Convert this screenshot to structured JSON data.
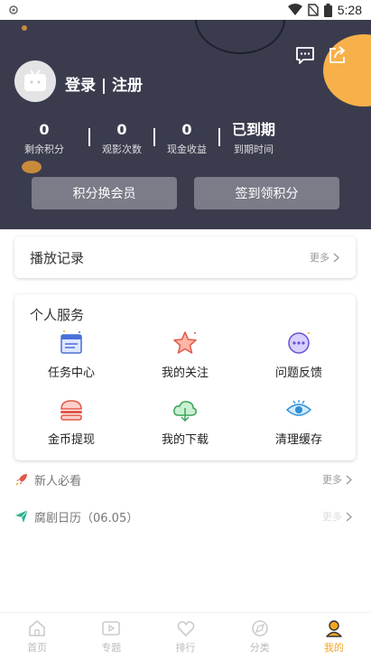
{
  "status": {
    "time": "5:28"
  },
  "profile": {
    "login_label": "登录 | 注册"
  },
  "stats": [
    {
      "value": "0",
      "label": "剩余积分"
    },
    {
      "value": "0",
      "label": "观影次数"
    },
    {
      "value": "0",
      "label": "现金收益"
    },
    {
      "value": "已到期",
      "label": "到期时间"
    }
  ],
  "buttons": {
    "exchange": "积分换会员",
    "checkin": "签到领积分"
  },
  "play_history": {
    "title": "播放记录",
    "more": "更多"
  },
  "services": {
    "title": "个人服务",
    "items": [
      {
        "label": "任务中心",
        "icon": "task-center-icon"
      },
      {
        "label": "我的关注",
        "icon": "star-icon"
      },
      {
        "label": "问题反馈",
        "icon": "feedback-icon"
      },
      {
        "label": "金币提现",
        "icon": "burger-icon"
      },
      {
        "label": "我的下载",
        "icon": "cloud-download-icon"
      },
      {
        "label": "清理缓存",
        "icon": "eye-icon"
      }
    ]
  },
  "rows": [
    {
      "title": "新人必看",
      "more": "更多",
      "icon": "rocket-icon"
    },
    {
      "title": "腐剧日历（06.05）",
      "more": "更多",
      "icon": "paper-plane-icon"
    }
  ],
  "tabs": [
    {
      "label": "首页",
      "icon": "home-icon"
    },
    {
      "label": "专题",
      "icon": "topic-icon"
    },
    {
      "label": "排行",
      "icon": "heart-icon"
    },
    {
      "label": "分类",
      "icon": "category-icon"
    },
    {
      "label": "我的",
      "icon": "profile-icon"
    }
  ],
  "colors": {
    "header_bg": "#3a3c4e",
    "accent": "#f5a623",
    "orange_deco": "#f8b04a"
  }
}
